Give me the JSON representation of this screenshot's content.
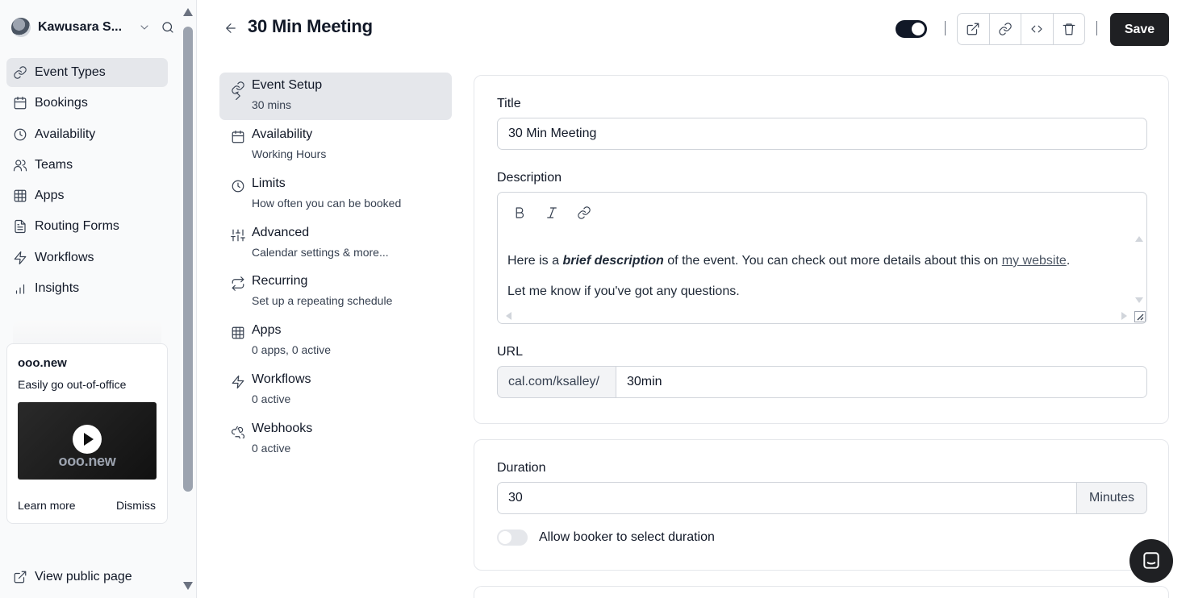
{
  "user": {
    "name": "Kawusara S..."
  },
  "sidebar": {
    "items": [
      {
        "label": "Event Types",
        "icon": "link-icon",
        "active": true
      },
      {
        "label": "Bookings",
        "icon": "calendar-icon"
      },
      {
        "label": "Availability",
        "icon": "clock-icon"
      },
      {
        "label": "Teams",
        "icon": "users-icon"
      },
      {
        "label": "Apps",
        "icon": "grid-icon"
      },
      {
        "label": "Routing Forms",
        "icon": "file-text-icon"
      },
      {
        "label": "Workflows",
        "icon": "zap-icon"
      },
      {
        "label": "Insights",
        "icon": "bar-chart-icon"
      }
    ],
    "promo": {
      "title": "ooo.new",
      "subtitle": "Easily go out-of-office",
      "video_wordmark": "ooo.new",
      "learn_more": "Learn more",
      "dismiss": "Dismiss"
    },
    "view_public_page": "View public page"
  },
  "header": {
    "title": "30 Min Meeting",
    "save_label": "Save",
    "hidden_toggle_on": true
  },
  "settings_nav": [
    {
      "title": "Event Setup",
      "subtitle": "30 mins",
      "icon": "link-icon",
      "active": true
    },
    {
      "title": "Availability",
      "subtitle": "Working Hours",
      "icon": "calendar-icon"
    },
    {
      "title": "Limits",
      "subtitle": "How often you can be booked",
      "icon": "clock-icon"
    },
    {
      "title": "Advanced",
      "subtitle": "Calendar settings & more...",
      "icon": "sliders-icon"
    },
    {
      "title": "Recurring",
      "subtitle": "Set up a repeating schedule",
      "icon": "repeat-icon"
    },
    {
      "title": "Apps",
      "subtitle": "0 apps, 0 active",
      "icon": "grid-icon"
    },
    {
      "title": "Workflows",
      "subtitle": "0 active",
      "icon": "zap-icon"
    },
    {
      "title": "Webhooks",
      "subtitle": "0 active",
      "icon": "webhook-icon"
    }
  ],
  "form": {
    "title_label": "Title",
    "title_value": "30 Min Meeting",
    "description_label": "Description",
    "description": {
      "p1_before": "Here is a ",
      "p1_bold": "brief description",
      "p1_after": " of the event. You can check out more details about this on ",
      "p1_link": "my website",
      "p1_end": ".",
      "p2": "Let me know if you've got any questions."
    },
    "url_label": "URL",
    "url_prefix": "cal.com/ksalley/",
    "url_slug": "30min",
    "duration_label": "Duration",
    "duration_value": "30",
    "duration_unit": "Minutes",
    "allow_duration_label": "Allow booker to select duration",
    "allow_duration_on": false
  },
  "colors": {
    "primary": "#1f2023",
    "active_bg": "#e5e7eb",
    "border": "#d1d5db"
  }
}
